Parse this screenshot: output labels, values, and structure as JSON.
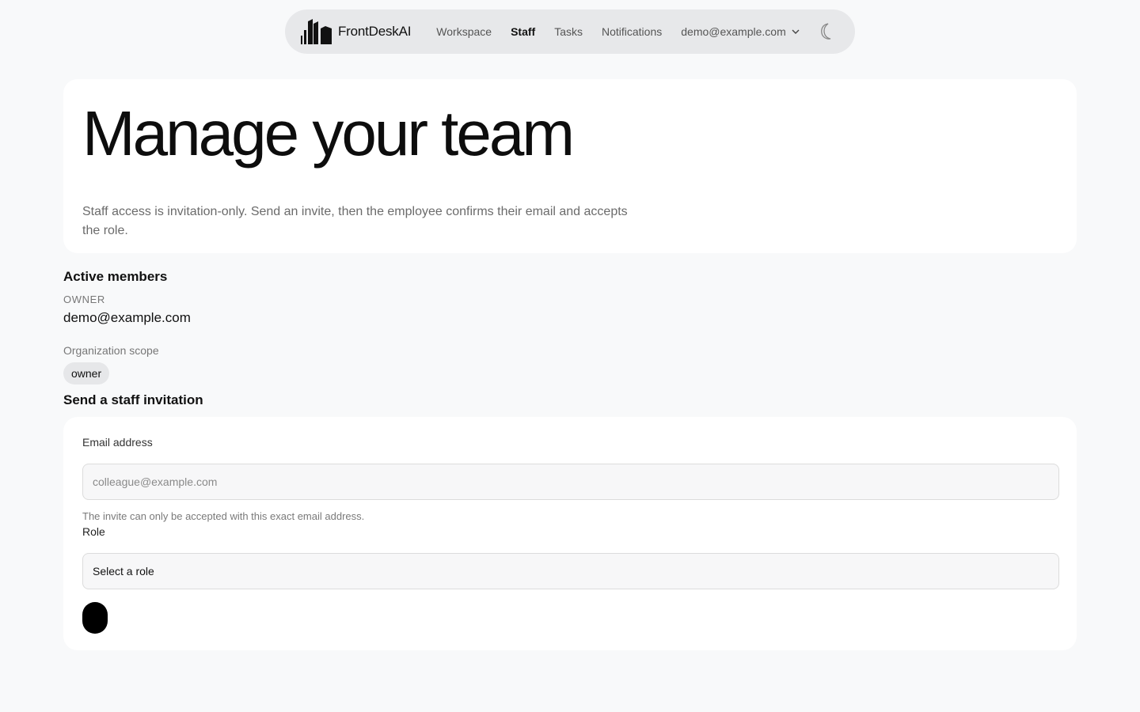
{
  "app": {
    "brand_name": "FrontDeskAI"
  },
  "nav": {
    "items": [
      {
        "label": "Workspace",
        "active": false
      },
      {
        "label": "Staff",
        "active": true
      },
      {
        "label": "Tasks",
        "active": false
      },
      {
        "label": "Notifications",
        "active": false
      }
    ],
    "account_email": "demo@example.com",
    "icons": {
      "logo": "buildings-logo-icon",
      "account_menu": "chevron-down-icon",
      "theme": "moon-icon"
    }
  },
  "hero": {
    "title": "Manage your team",
    "description": "Staff access is invitation-only. Send an invite, then the employee confirms their email and accepts the role."
  },
  "members": {
    "section_title": "Active members",
    "items": [
      {
        "role_caption": "OWNER",
        "email": "demo@example.com",
        "scope_label": "Organization scope",
        "scope_chip": "owner"
      }
    ]
  },
  "invite": {
    "section_title": "Send a staff invitation",
    "email_label": "Email address",
    "email_value": "",
    "email_placeholder": "colleague@example.com",
    "email_hint": "The invite can only be accepted with this exact email address.",
    "role_label": "Role",
    "role_selected": "Select a role"
  },
  "colors": {
    "page_bg": "#f8f9fa",
    "nav_bg": "#e7e8ea",
    "card_bg": "#ffffff",
    "primary": "#000000",
    "chip_bg": "#e6e7e9"
  }
}
